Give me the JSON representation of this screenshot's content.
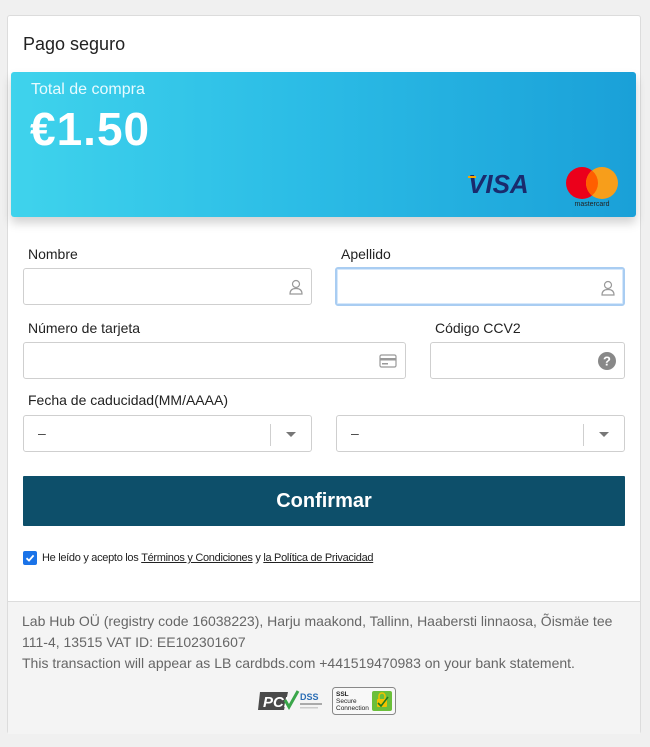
{
  "header": {
    "title": "Pago seguro"
  },
  "summary": {
    "total_label": "Total de compra",
    "total_amount": "€1.50",
    "brands": [
      "VISA",
      "mastercard"
    ]
  },
  "form": {
    "first_name": {
      "label": "Nombre",
      "value": ""
    },
    "last_name": {
      "label": "Apellido",
      "value": ""
    },
    "card_number": {
      "label": "Número de tarjeta",
      "value": ""
    },
    "cvv": {
      "label": "Código CCV2",
      "value": ""
    },
    "expiry": {
      "label": "Fecha de caducidad(MM/AAAA)",
      "month_value": "–",
      "year_value": "–"
    }
  },
  "actions": {
    "confirm_label": "Confirmar"
  },
  "terms": {
    "checked": true,
    "prefix": "He leído y acepto los ",
    "terms_link": "Términos y Condiciones",
    "middle": " y ",
    "privacy_link": "la Política de Privacidad"
  },
  "footer": {
    "line1": "Lab Hub OÜ (registry code 16038223), Harju maakond, Tallinn, Haabersti linnaosa, Õismäe tee 111-4, 13515 VAT ID: EE102301607",
    "line2": "This transaction will appear as LB cardbds.com +441519470983 on your bank statement.",
    "badges": {
      "pci": "PCI",
      "dss": "DSS",
      "ssl_line1": "SSL",
      "ssl_line2": "Secure",
      "ssl_line3": "Connection"
    }
  },
  "colors": {
    "accent": "#0d4f6a",
    "banner_start": "#3fd3ec",
    "banner_end": "#1aa0d8",
    "checkbox": "#1a73e8"
  }
}
